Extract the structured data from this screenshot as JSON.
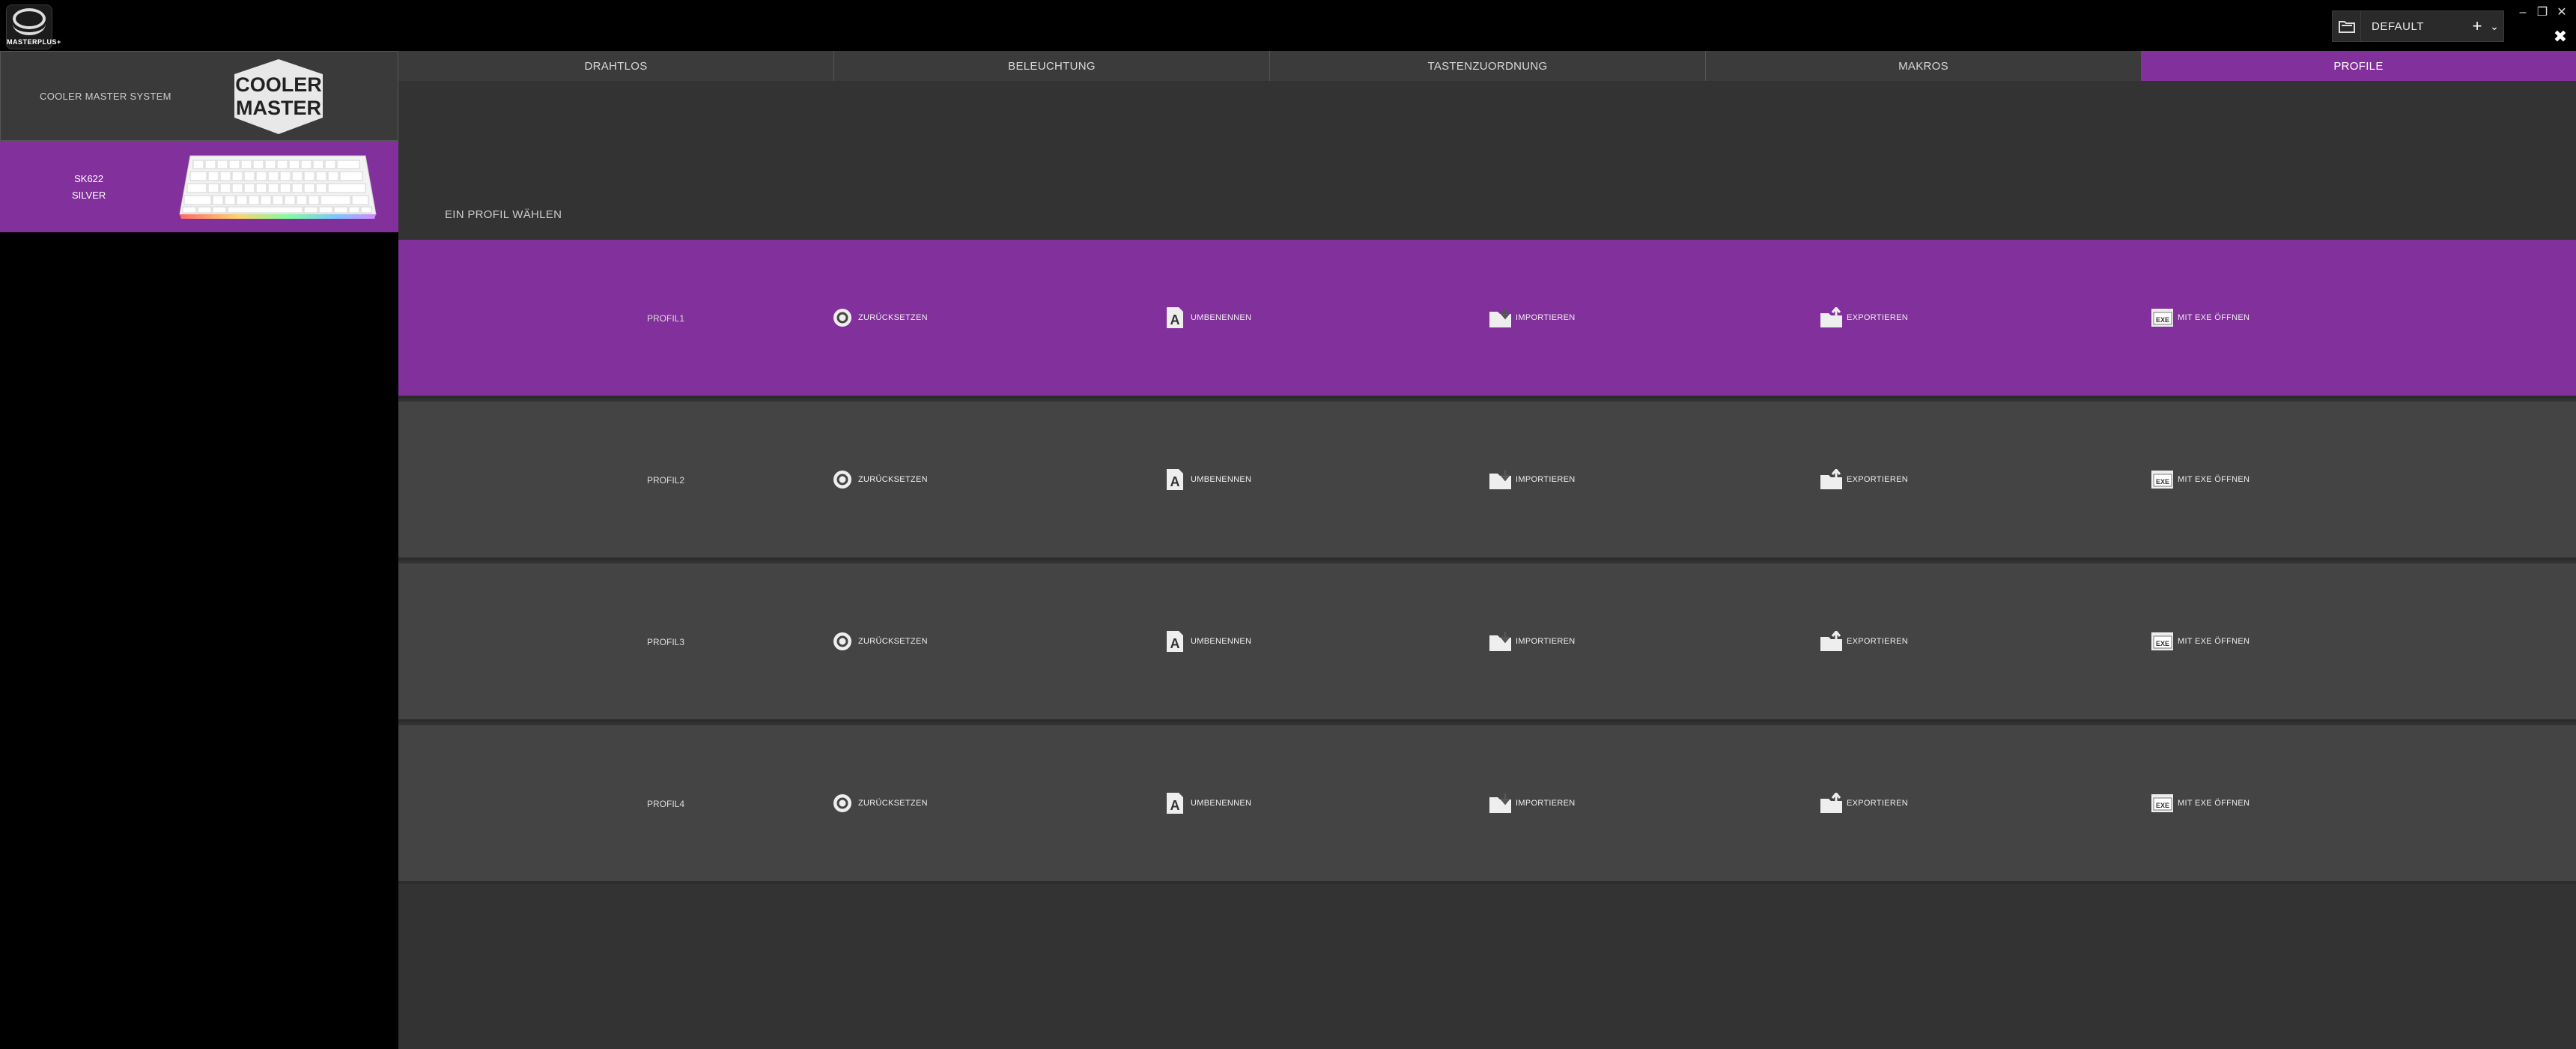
{
  "app": {
    "logo_text": "MASTERPLUS+"
  },
  "window": {
    "minimize": "–",
    "maximize": "❐",
    "close": "✕",
    "close_alt": "✖"
  },
  "profile_selector": {
    "value": "DEFAULT",
    "add": "+",
    "dropdown": "⌄"
  },
  "sidebar": {
    "system_label": "COOLER MASTER SYSTEM",
    "brand_logo_text": [
      "COOLER",
      "MASTER"
    ],
    "device": {
      "name_line1": "SK622",
      "name_line2": "SILVER"
    }
  },
  "tabs": [
    {
      "label": "DRAHTLOS",
      "active": false
    },
    {
      "label": "BELEUCHTUNG",
      "active": false
    },
    {
      "label": "TASTENZUORDNUNG",
      "active": false
    },
    {
      "label": "MAKROS",
      "active": false
    },
    {
      "label": "PROFILE",
      "active": true
    }
  ],
  "main": {
    "section_title": "EIN PROFIL WÄHLEN",
    "profiles": [
      {
        "name": "PROFIL1",
        "active": true
      },
      {
        "name": "PROFIL2",
        "active": false
      },
      {
        "name": "PROFIL3",
        "active": false
      },
      {
        "name": "PROFIL4",
        "active": false
      }
    ],
    "actions": {
      "reset": "ZURÜCKSETZEN",
      "rename": "UMBENENNEN",
      "import": "IMPORTIEREN",
      "export": "EXPORTIEREN",
      "exe": "MIT EXE ÖFFNEN",
      "exe_icon_text": "EXE",
      "rename_icon_text": "A"
    }
  },
  "colors": {
    "accent": "#82309b",
    "row": "#444444",
    "main_bg": "#333333",
    "sidebar_bg": "#000000"
  }
}
